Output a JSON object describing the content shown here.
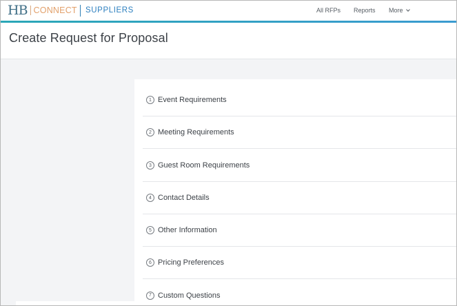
{
  "brand": {
    "logo_hb": "HB",
    "logo_connect": "CONNECT",
    "product": "SUPPLIERS"
  },
  "nav": {
    "all_rfps": "All RFPs",
    "reports": "Reports",
    "more": "More"
  },
  "header": {
    "title": "Create Request for Proposal"
  },
  "steps": [
    {
      "number": "1",
      "label": "Event Requirements"
    },
    {
      "number": "2",
      "label": "Meeting Requirements"
    },
    {
      "number": "3",
      "label": "Guest Room Requirements"
    },
    {
      "number": "4",
      "label": "Contact Details"
    },
    {
      "number": "5",
      "label": "Other Information"
    },
    {
      "number": "6",
      "label": "Pricing Preferences"
    },
    {
      "number": "7",
      "label": "Custom Questions"
    }
  ],
  "colors": {
    "accent": "#2aa7b7",
    "brand_blue": "#2c7fbf",
    "brand_orange": "#e2a06b",
    "text": "#3c4147"
  }
}
